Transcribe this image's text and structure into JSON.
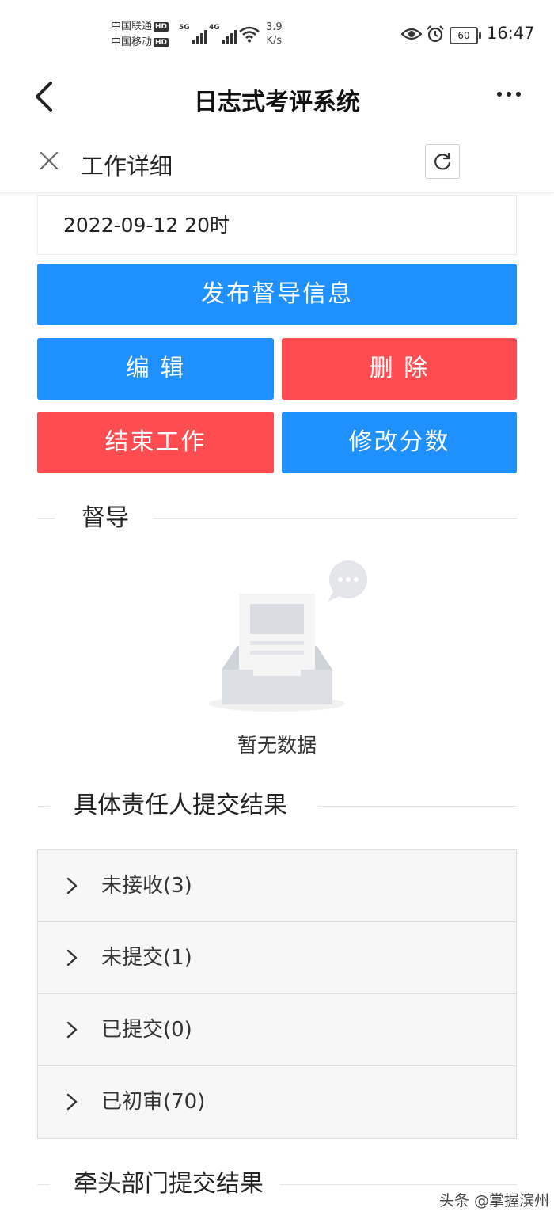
{
  "status_bar": {
    "carrier_1": "中国联通",
    "carrier_2": "中国移动",
    "hd": "HD",
    "net_5g": "5G",
    "net_4g": "4G",
    "speed_value": "3.9",
    "speed_unit": "K/s",
    "battery": "60",
    "time": "16:47"
  },
  "header": {
    "title": "日志式考评系统"
  },
  "subheader": {
    "title": "工作详细"
  },
  "date_field": {
    "value": "2022-09-12 20时"
  },
  "buttons": {
    "publish": "发布督导信息",
    "edit": "编 辑",
    "delete": "删 除",
    "end_work": "结束工作",
    "modify_score": "修改分数"
  },
  "sections": {
    "supervision": "督导",
    "responsible_results": "具体责任人提交结果",
    "lead_dept_results": "牵头部门提交结果"
  },
  "empty_state": {
    "text": "暂无数据"
  },
  "collapse_items": [
    {
      "label": "未接收(3)"
    },
    {
      "label": "未提交(1)"
    },
    {
      "label": "已提交(0)"
    },
    {
      "label": "已初审(70)"
    }
  ],
  "watermark": "头条 @掌握滨州",
  "colors": {
    "primary_blue": "#1e90ff",
    "danger_red": "#fe4c50"
  }
}
